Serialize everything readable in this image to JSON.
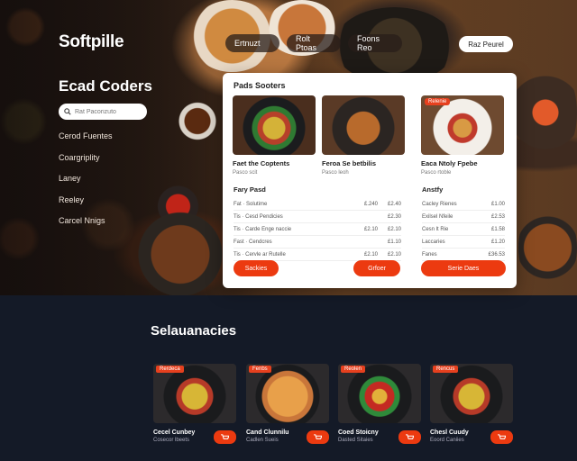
{
  "brand": "Softpille",
  "nav": {
    "items": [
      "Ertnuzt",
      "Rolt Ptoas",
      "Foons Reo"
    ],
    "cta": "Raz Peurel"
  },
  "sidebar": {
    "title": "Ecad Coders",
    "search_placeholder": "Rat Pacorizuto",
    "items": [
      "Cerod Fuentes",
      "Coargriplity",
      "Laney",
      "Reeley",
      "Carcel Nnigs"
    ]
  },
  "panel": {
    "title": "Pads Sooters",
    "cards": [
      {
        "name": "Faet the Coptents",
        "sub": "Pasco scit",
        "badge": ""
      },
      {
        "name": "Feroa Se betbilis",
        "sub": "Pasco leoh",
        "badge": ""
      },
      {
        "name": "Eaca Ntoly Fpebe",
        "sub": "Pasco rtoble",
        "badge": "Relenie"
      }
    ],
    "menu_left": {
      "header": "Fary Pasd",
      "rows": [
        {
          "item": "Fat · Solutime",
          "p1": "£.240",
          "p2": "£2.40"
        },
        {
          "item": "Tis · Cesd Pendicies",
          "p1": "",
          "p2": "£2.30"
        },
        {
          "item": "Tis · Carde Enge naccie",
          "p1": "£2.10",
          "p2": "£2.10"
        },
        {
          "item": "Fast · Cendcres",
          "p1": "",
          "p2": "£1.10"
        },
        {
          "item": "Tis · Cervle ar Rutelle",
          "p1": "£2.10",
          "p2": "£2.10"
        }
      ]
    },
    "menu_right": {
      "header": "Anstfy",
      "rows": [
        {
          "item": "Cacley Rienes",
          "p2": "£1.00"
        },
        {
          "item": "Exilsel Nfeile",
          "p2": "£2.53"
        },
        {
          "item": "Cesn lt Rie",
          "p2": "£1.58"
        },
        {
          "item": "Laccaries",
          "p2": "£1.20"
        },
        {
          "item": "Fanes",
          "p2": "£36.53"
        }
      ]
    },
    "buttons": [
      "Sackies",
      "Grfoer",
      "Serie Daes"
    ]
  },
  "section": {
    "title": "Selauanacies",
    "dishes": [
      {
        "badge": "Rerdeca",
        "name": "Cecel Cunbey",
        "sub": "Cosecor lbeets"
      },
      {
        "badge": "Fenbs",
        "name": "Cand Clunnilu",
        "sub": "Cadlen Sueis"
      },
      {
        "badge": "Reolen",
        "name": "Coed Stoicny",
        "sub": "Dasted Sitaies"
      },
      {
        "badge": "Rencus",
        "name": "Chesl Cuudy",
        "sub": "Eoord Caniies"
      }
    ]
  },
  "colors": {
    "accent": "#ec3a10",
    "background": "#141a27"
  }
}
